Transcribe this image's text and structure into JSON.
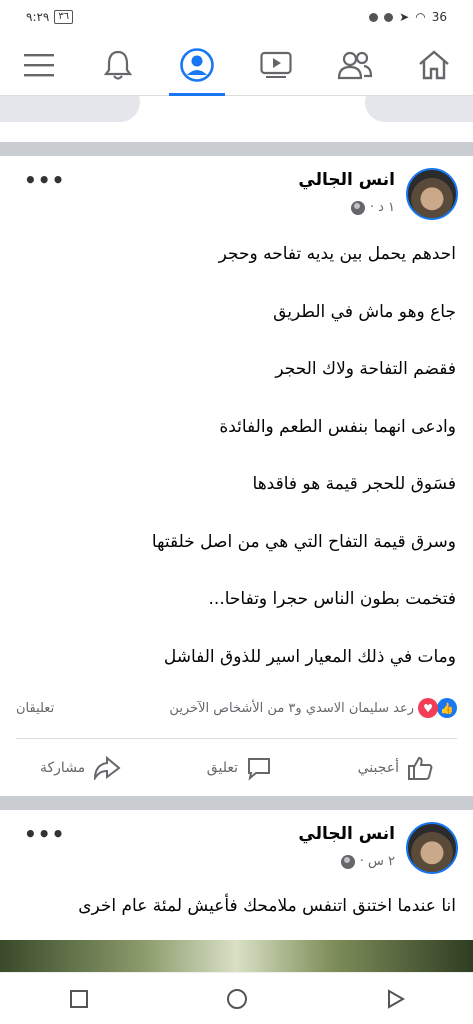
{
  "status_bar": {
    "time": "٩:٢٩",
    "battery": "٣٦",
    "network": "36"
  },
  "nav": {
    "items": [
      "menu",
      "notifications",
      "profile",
      "watch",
      "groups",
      "home"
    ],
    "active": "profile"
  },
  "posts": [
    {
      "author": "انس الجالي",
      "time": "١ د ·",
      "lines": [
        "احدهم يحمل بين يديه تفاحه وحجر",
        "جاع وهو ماش في الطريق",
        "فقضم التفاحة ولاك الحجر",
        "وادعى انهما بنفس الطعم والفائدة",
        "فسَوق للحجر قيمة هو فاقدها",
        "وسرق قيمة التفاح التي هي من اصل خلقتها",
        "فتخمت بطون الناس حجرا وتفاحا...",
        "ومات في ذلك المعيار اسير للذوق الفاشل"
      ],
      "reactions_text": "رعد سليمان الاسدي و٣ من الأشخاص الآخرين",
      "comments_text": "تعليقان",
      "actions": {
        "like": "أعجبني",
        "comment": "تعليق",
        "share": "مشاركة"
      }
    },
    {
      "author": "انس الجالي",
      "time": "٢ س ·",
      "lines": [
        "انا عندما اختنق اتنفس ملامحك فأعيش لمئة عام اخرى"
      ]
    }
  ]
}
